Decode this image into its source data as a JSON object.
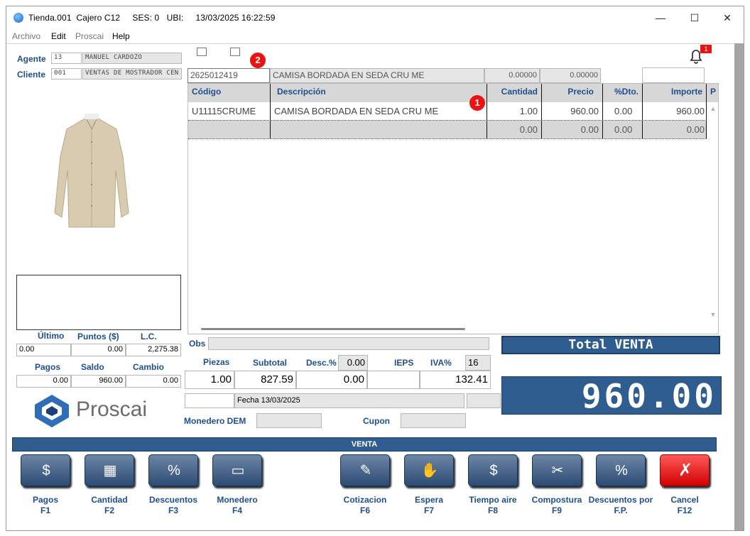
{
  "window": {
    "title": "Tienda.001  Cajero C12     SES: 0   UBI:     13/03/2025 16:22:59",
    "controls": {
      "minimize": "—",
      "maximize": "☐",
      "close": "✕"
    }
  },
  "menu": [
    "Archivo",
    "Edit",
    "Proscai",
    "Help"
  ],
  "agent": {
    "label": "Agente",
    "code": "13",
    "name": "MANUEL CARDOZO"
  },
  "client": {
    "label": "Cliente",
    "code": "001",
    "name": "VENTAS DE MOSTRADOR CEN"
  },
  "scan": {
    "code": "2625012419",
    "description": "CAMISA BORDADA EN SEDA CRU ME",
    "v1": "0.00000",
    "v2": "0.00000",
    "extra": ""
  },
  "notification": {
    "count": "1"
  },
  "markers": {
    "m1": "1",
    "m2": "2"
  },
  "grid": {
    "headers": [
      "Código",
      "Descripción",
      "Cantidad",
      "Precio",
      "%Dto.",
      "Importe",
      "P"
    ],
    "rows": [
      [
        "U11115CRUME",
        "CAMISA BORDADA EN SEDA CRU ME",
        "1.00",
        "960.00",
        "0.00",
        "960.00"
      ],
      [
        "",
        "",
        "0.00",
        "0.00",
        "0.00",
        "0.00"
      ]
    ]
  },
  "stats": {
    "ultimo_label": "Último",
    "puntos_label": "Puntos ($)",
    "lc_label": "L.C.",
    "ultimo": "0.00",
    "puntos": "0.00",
    "lc": "2,275.38",
    "pagos_label": "Pagos",
    "saldo_label": "Saldo",
    "cambio_label": "Cambio",
    "pagos": "0.00",
    "saldo": "960.00",
    "cambio": "0.00"
  },
  "obs": {
    "label": "Obs",
    "value": ""
  },
  "summary": {
    "piezas_label": "Piezas",
    "subtotal_label": "Subtotal",
    "desc_label": "Desc.%",
    "desc_pct": "0.00",
    "ieps_label": "IEPS",
    "iva_label": "IVA%",
    "iva_pct": "16",
    "piezas": "1.00",
    "subtotal": "827.59",
    "descuento": "0.00",
    "ieps": "",
    "iva": "132.41"
  },
  "fecha": "Fecha 13/03/2025",
  "monedero_label": "Monedero DEM",
  "cupon_label": "Cupon",
  "total": {
    "label": "Total VENTA",
    "value": "960.00"
  },
  "logo_text": "Proscai",
  "venta_bar": "VENTA",
  "buttons": [
    {
      "name": "pagos",
      "line1": "Pagos",
      "line2": "F1",
      "icon": "$"
    },
    {
      "name": "cantidad",
      "line1": "Cantidad",
      "line2": "F2",
      "icon": "▦"
    },
    {
      "name": "descuentos",
      "line1": "Descuentos",
      "line2": "F3",
      "icon": "%"
    },
    {
      "name": "monedero",
      "line1": "Monedero",
      "line2": "F4",
      "icon": "▭"
    },
    {
      "name": "cotizacion",
      "line1": "Cotizacion",
      "line2": "F6",
      "icon": "✎"
    },
    {
      "name": "espera",
      "line1": "Espera",
      "line2": "F7",
      "icon": "✋"
    },
    {
      "name": "tiempo-aire",
      "line1": "Tiempo aire",
      "line2": "F8",
      "icon": "$"
    },
    {
      "name": "compostura",
      "line1": "Compostura",
      "line2": "F9",
      "icon": "✂"
    },
    {
      "name": "descuentos-fp",
      "line1": "Descuentos por",
      "line2": "F.P.",
      "icon": "%"
    },
    {
      "name": "cancel",
      "line1": "Cancel",
      "line2": "F12",
      "icon": "✗"
    }
  ]
}
